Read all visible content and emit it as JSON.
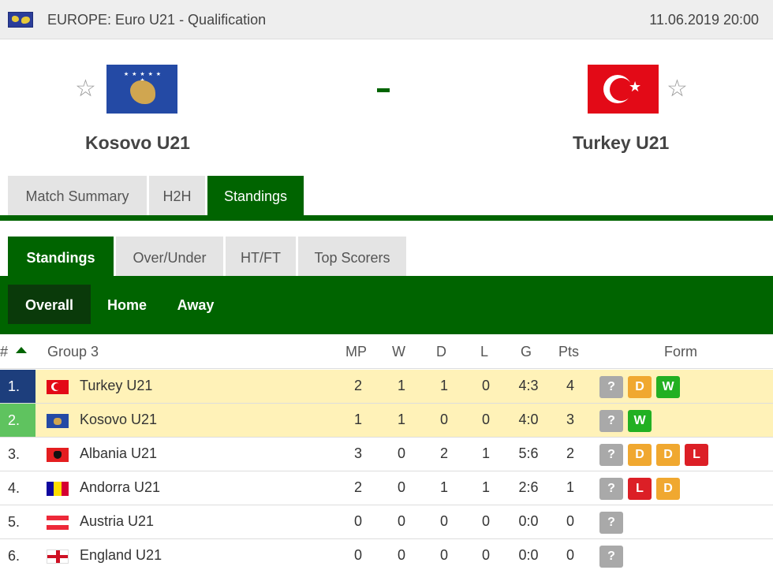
{
  "topbar": {
    "league": "EUROPE: Euro U21 - Qualification",
    "datetime": "11.06.2019 20:00"
  },
  "match": {
    "home": "Kosovo U21",
    "away": "Turkey U21",
    "score": "-"
  },
  "main_tabs": [
    "Match Summary",
    "H2H",
    "Standings"
  ],
  "sub_tabs": [
    "Standings",
    "Over/Under",
    "HT/FT",
    "Top Scorers"
  ],
  "filters": [
    "Overall",
    "Home",
    "Away"
  ],
  "table": {
    "headers": {
      "rank": "#",
      "group": "Group 3",
      "mp": "MP",
      "w": "W",
      "d": "D",
      "l": "L",
      "g": "G",
      "pts": "Pts",
      "form": "Form"
    },
    "rows": [
      {
        "rank": "1.",
        "team": "Turkey U21",
        "flag": "turkey",
        "mp": "2",
        "w": "1",
        "d": "1",
        "l": "0",
        "g": "4:3",
        "pts": "4",
        "form": [
          "?",
          "D",
          "W"
        ]
      },
      {
        "rank": "2.",
        "team": "Kosovo U21",
        "flag": "kosovo",
        "mp": "1",
        "w": "1",
        "d": "0",
        "l": "0",
        "g": "4:0",
        "pts": "3",
        "form": [
          "?",
          "W"
        ]
      },
      {
        "rank": "3.",
        "team": "Albania U21",
        "flag": "albania",
        "mp": "3",
        "w": "0",
        "d": "2",
        "l": "1",
        "g": "5:6",
        "pts": "2",
        "form": [
          "?",
          "D",
          "D",
          "L"
        ]
      },
      {
        "rank": "4.",
        "team": "Andorra U21",
        "flag": "andorra",
        "mp": "2",
        "w": "0",
        "d": "1",
        "l": "1",
        "g": "2:6",
        "pts": "1",
        "form": [
          "?",
          "L",
          "D"
        ]
      },
      {
        "rank": "5.",
        "team": "Austria U21",
        "flag": "austria",
        "mp": "0",
        "w": "0",
        "d": "0",
        "l": "0",
        "g": "0:0",
        "pts": "0",
        "form": [
          "?"
        ]
      },
      {
        "rank": "6.",
        "team": "England U21",
        "flag": "england",
        "mp": "0",
        "w": "0",
        "d": "0",
        "l": "0",
        "g": "0:0",
        "pts": "0",
        "form": [
          "?"
        ]
      }
    ]
  },
  "colors": {
    "brand_green": "#006400",
    "highlight_row": "#fff2b8",
    "rank1": "#1d3e7c",
    "rank2": "#5fc35f",
    "form_unknown": "#a9a9a9",
    "form_draw": "#f0a830",
    "form_win": "#22b022",
    "form_loss": "#dc1f26"
  }
}
